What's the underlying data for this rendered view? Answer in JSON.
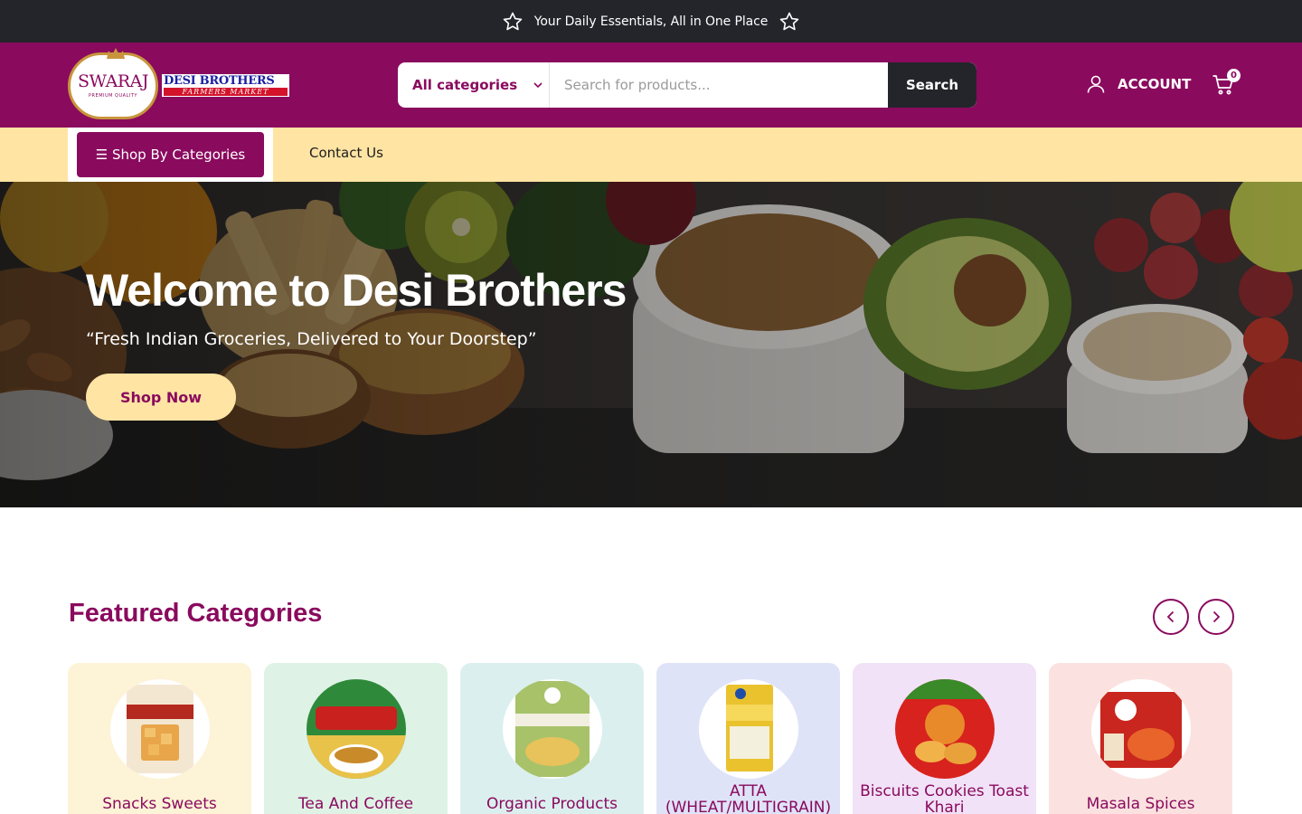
{
  "topbar": {
    "message": "Your Daily Essentials, All in One Place",
    "icon": "star-icon"
  },
  "header": {
    "logo": {
      "badge_text": "SWARAJ",
      "badge_subtext": "PREMIUM QUALITY",
      "title": "DESI BROTHERS",
      "subtitle": "FARMERS MARKET"
    },
    "search": {
      "category_label": "All categories",
      "placeholder": "Search for products...",
      "button_label": "Search"
    },
    "account_label": "ACCOUNT",
    "cart_count": "0"
  },
  "nav": {
    "shop_by_categories": "☰ Shop By Categories",
    "contact_us": "Contact Us"
  },
  "hero": {
    "title": "Welcome to Desi Brothers",
    "tagline": "“Fresh Indian Groceries, Delivered to Your Doorstep”",
    "cta": "Shop Now"
  },
  "featured": {
    "title": "Featured Categories",
    "categories": [
      {
        "name": "Snacks Sweets",
        "bg": "#fdf3d6"
      },
      {
        "name": "Tea And Coffee",
        "bg": "#dff2e6"
      },
      {
        "name": "Organic Products",
        "bg": "#dcefef"
      },
      {
        "name": "ATTA (WHEAT/MULTIGRAIN)",
        "bg": "#dfe3f7"
      },
      {
        "name": "Biscuits Cookies Toast Khari",
        "bg": "#f1e2f7"
      },
      {
        "name": "Masala Spices",
        "bg": "#fbe2e0"
      }
    ]
  },
  "colors": {
    "brand": "#8a0a5e",
    "topbar": "#23252a",
    "nav_bg": "#ffe4a3",
    "cta_bg": "#ffe4a3"
  }
}
